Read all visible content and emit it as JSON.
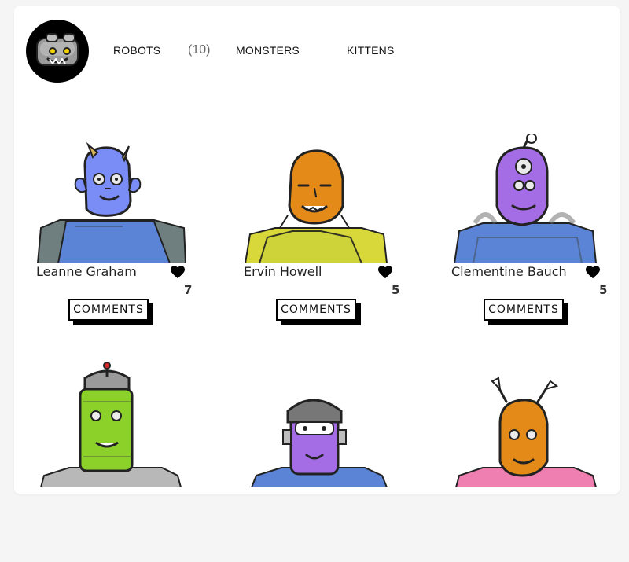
{
  "nav": {
    "items": [
      {
        "label": "ROBOTS"
      },
      {
        "label": "MONSTERS"
      },
      {
        "label": "KITTENS"
      }
    ],
    "count": "(10)"
  },
  "cards": [
    {
      "name": "Leanne Graham",
      "likes": "7",
      "comments_label": "COMMENTS"
    },
    {
      "name": "Ervin Howell",
      "likes": "5",
      "comments_label": "COMMENTS"
    },
    {
      "name": "Clementine Bauch",
      "likes": "5",
      "comments_label": "COMMENTS"
    },
    {
      "name": "",
      "likes": "",
      "comments_label": ""
    },
    {
      "name": "",
      "likes": "",
      "comments_label": ""
    },
    {
      "name": "",
      "likes": "",
      "comments_label": ""
    }
  ],
  "colors": {
    "monster_blue": "#7a8cf5",
    "monster_orange": "#e38a18",
    "monster_purple": "#a46de6",
    "monster_green": "#8bd12a",
    "suit_blue": "#5b84d7",
    "suit_yellow": "#d9d83a",
    "suit_gray": "#b8b8b8"
  },
  "icons": {
    "logo": "robot-head-icon",
    "like": "heart-icon"
  }
}
